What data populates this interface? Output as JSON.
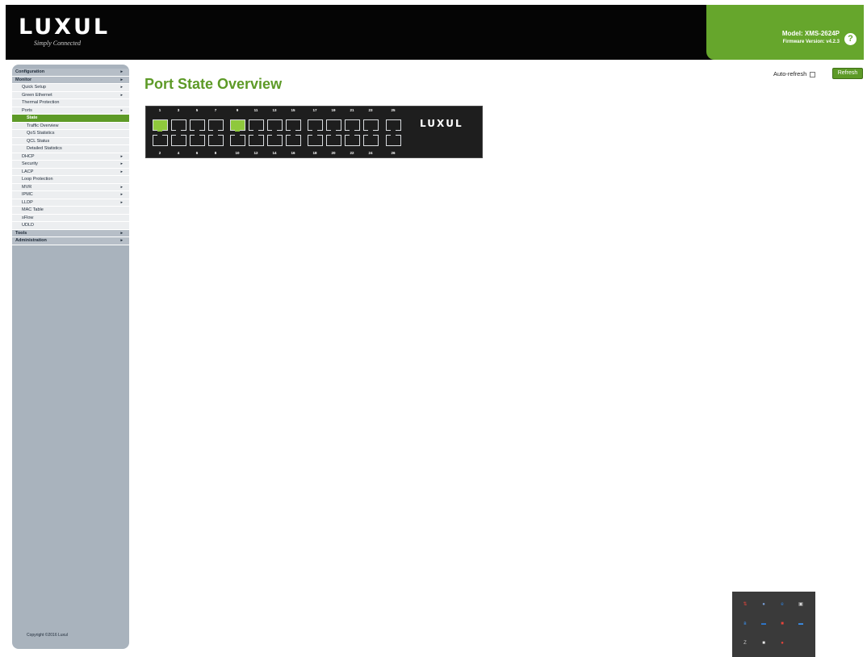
{
  "header": {
    "logo_text": "LUXUL",
    "logo_tagline": "Simply Connected",
    "model": "Model: XMS-2624P",
    "firmware": "Firmware Version: v4.2.3"
  },
  "toolbar": {
    "auto_refresh_label": "Auto-refresh",
    "auto_refresh_checked": false,
    "refresh_label": "Refresh"
  },
  "main": {
    "title": "Port State Overview"
  },
  "sidebar": {
    "items": [
      {
        "label": "Configuration",
        "level": 0,
        "arrow": true
      },
      {
        "label": "Monitor",
        "level": 0,
        "arrow": true
      },
      {
        "label": "Quick Setup",
        "level": 1,
        "arrow": true
      },
      {
        "label": "Green Ethernet",
        "level": 1,
        "arrow": true
      },
      {
        "label": "Thermal Protection",
        "level": 1,
        "arrow": false
      },
      {
        "label": "Ports",
        "level": 1,
        "arrow": true
      },
      {
        "label": "State",
        "level": 2,
        "arrow": false,
        "active": true
      },
      {
        "label": "Traffic Overview",
        "level": 2,
        "arrow": false
      },
      {
        "label": "QoS Statistics",
        "level": 2,
        "arrow": false
      },
      {
        "label": "QCL Status",
        "level": 2,
        "arrow": false
      },
      {
        "label": "Detailed Statistics",
        "level": 2,
        "arrow": false
      },
      {
        "label": "DHCP",
        "level": 1,
        "arrow": true
      },
      {
        "label": "Security",
        "level": 1,
        "arrow": true
      },
      {
        "label": "LACP",
        "level": 1,
        "arrow": true
      },
      {
        "label": "Loop Protection",
        "level": 1,
        "arrow": false
      },
      {
        "label": "MVR",
        "level": 1,
        "arrow": true
      },
      {
        "label": "IPMC",
        "level": 1,
        "arrow": true
      },
      {
        "label": "LLDP",
        "level": 1,
        "arrow": true
      },
      {
        "label": "MAC Table",
        "level": 1,
        "arrow": false
      },
      {
        "label": "sFlow",
        "level": 1,
        "arrow": false
      },
      {
        "label": "UDLD",
        "level": 1,
        "arrow": false
      },
      {
        "label": "Tools",
        "level": 0,
        "arrow": true
      },
      {
        "label": "Administration",
        "level": 0,
        "arrow": true
      }
    ],
    "copyright": "Copyright ©2016 Luxul"
  },
  "switch": {
    "logo_text": "LUXUL",
    "top_ports": [
      "1",
      "3",
      "5",
      "7",
      "9",
      "11",
      "13",
      "15",
      "17",
      "19",
      "21",
      "23",
      "25"
    ],
    "bottom_ports": [
      "2",
      "4",
      "6",
      "8",
      "10",
      "12",
      "14",
      "16",
      "18",
      "20",
      "22",
      "24",
      "26"
    ],
    "linked_ports": [
      "1",
      "9"
    ]
  },
  "tray": {
    "icons": [
      "network-icon",
      "app-icon",
      "edge-icon",
      "app-icon",
      "bluetooth-icon",
      "app-icon",
      "app-icon",
      "chat-icon",
      "app-icon",
      "app-icon",
      "app-icon"
    ]
  },
  "colors": {
    "accent": "#5d9a27",
    "header_bg": "#050505",
    "sidebar_bg": "#a9b3bd",
    "link_port": "#8fc83c"
  }
}
